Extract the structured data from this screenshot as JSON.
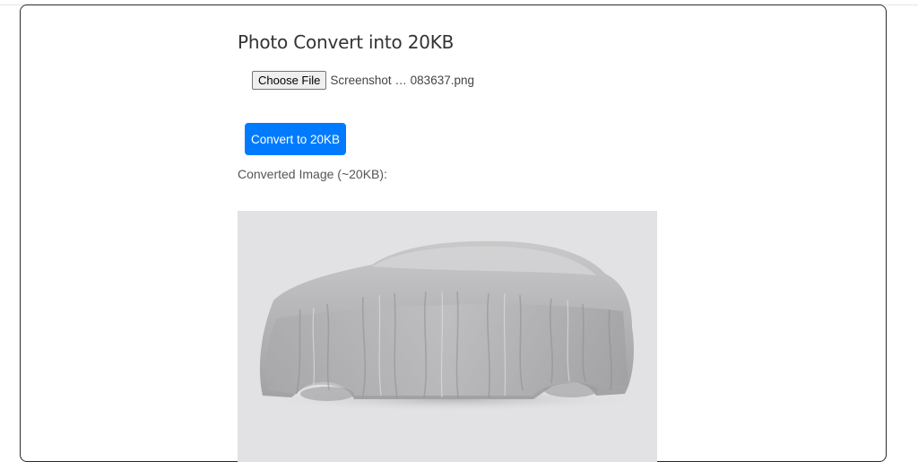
{
  "page": {
    "title": "Photo Convert into 20KB"
  },
  "file_input": {
    "button_label": "Choose File",
    "selected_file": "Screenshot … 083637.png"
  },
  "actions": {
    "convert_label": "Convert to 20KB"
  },
  "result": {
    "label": "Converted Image (~20KB):",
    "image_description": "car-under-cover"
  },
  "colors": {
    "accent": "#007bff",
    "image_background": "#e2e2e4"
  }
}
